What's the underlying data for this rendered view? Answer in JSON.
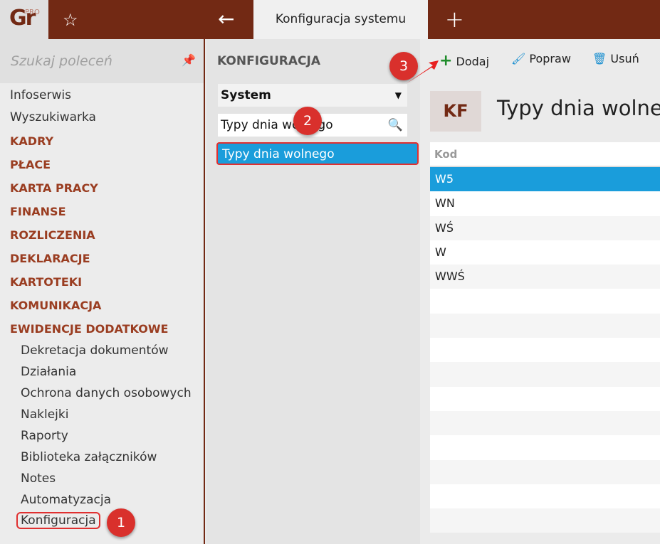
{
  "app": {
    "logo": "Gr",
    "logo_sup": "PRO",
    "tab": "Konfiguracja systemu"
  },
  "sidebar": {
    "search_placeholder": "Szukaj poleceń",
    "top_items": [
      "Infoserwis",
      "Wyszukiwarka"
    ],
    "sections": [
      "KADRY",
      "PŁACE",
      "KARTA PRACY",
      "FINANSE",
      "ROZLICZENIA",
      "DEKLARACJE",
      "KARTOTEKI",
      "KOMUNIKACJA",
      "EWIDENCJE DODATKOWE"
    ],
    "sub_items": [
      "Dekretacja dokumentów",
      "Działania",
      "Ochrona danych osobowych",
      "Naklejki",
      "Raporty",
      "Biblioteka załączników",
      "Notes",
      "Automatyzacja",
      "Konfiguracja"
    ]
  },
  "config": {
    "title": "KONFIGURACJA",
    "select": "System",
    "search": "Typy dnia wolnego",
    "result": "Typy dnia wolnego"
  },
  "toolbar": {
    "add": "Dodaj",
    "edit": "Popraw",
    "delete": "Usuń"
  },
  "main": {
    "badge": "KF",
    "title": "Typy dnia wolnego",
    "column": "Kod",
    "rows": [
      "W5",
      "WN",
      "WŚ",
      "W",
      "WWŚ"
    ]
  },
  "steps": [
    "1",
    "2",
    "3"
  ]
}
